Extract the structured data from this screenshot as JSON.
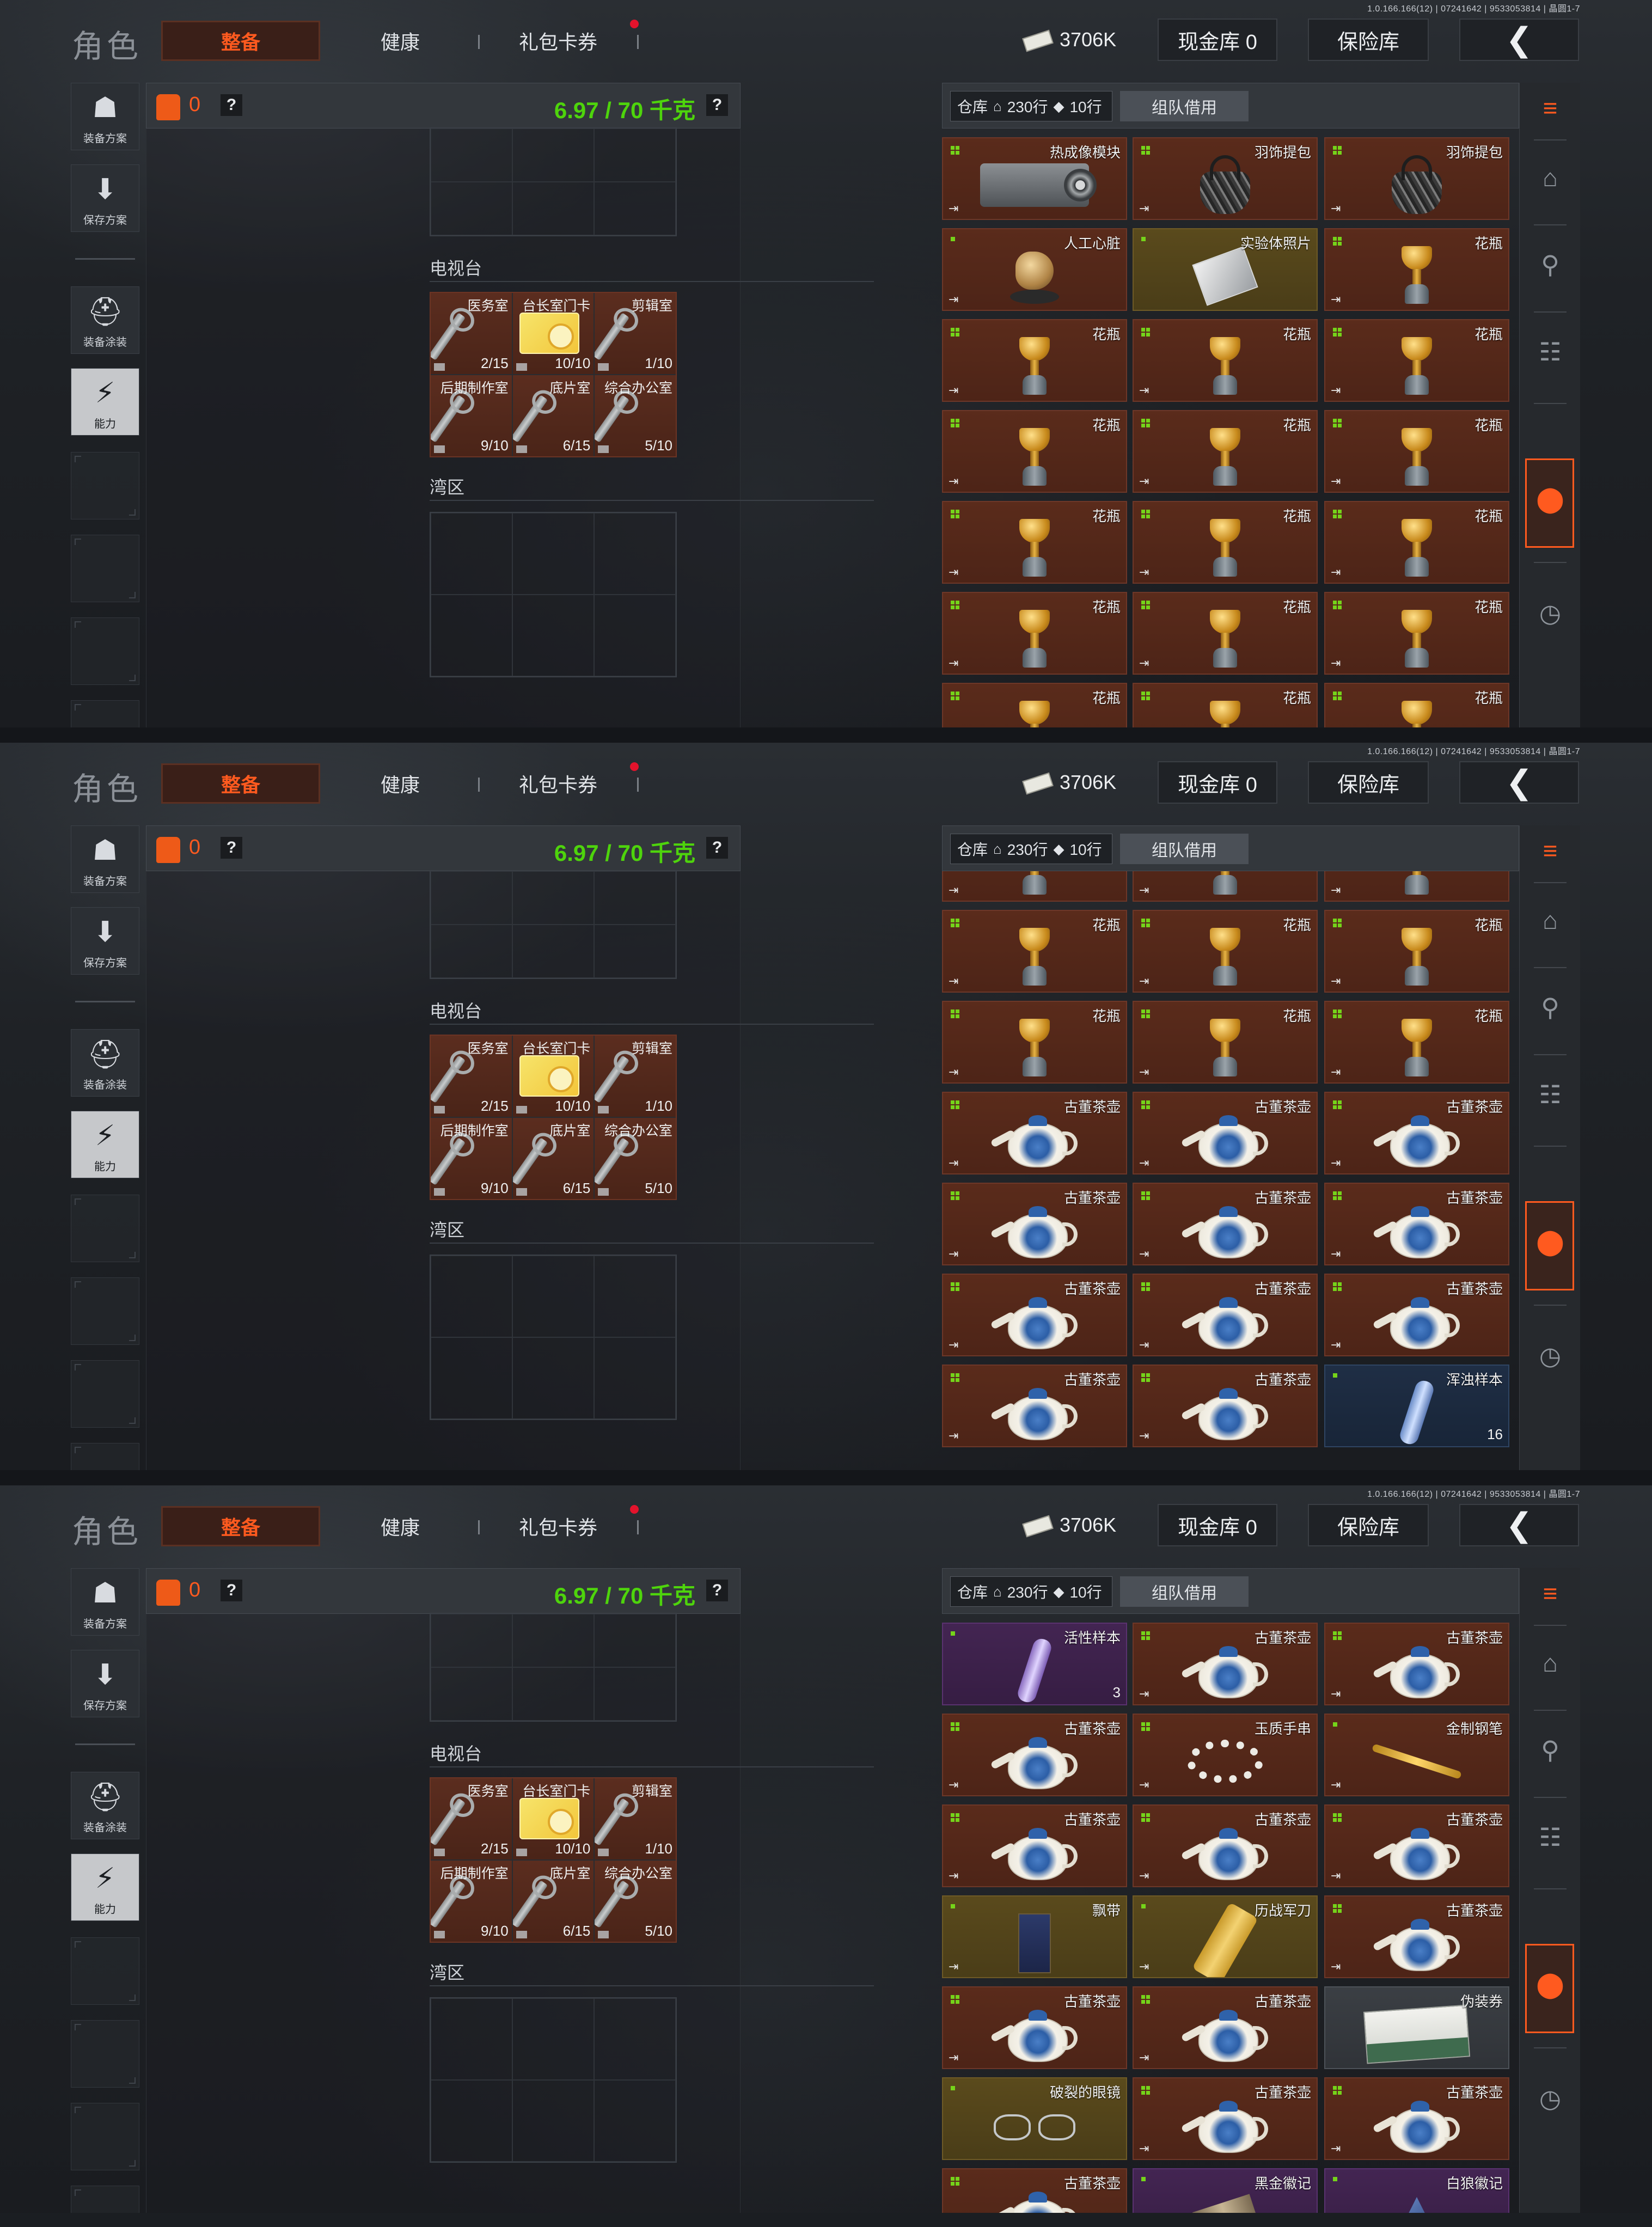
{
  "version": "1.0.166.166(12) | 07241642 | 9533053814 | 晶圆1-7",
  "header": {
    "role_title": "角色",
    "tabs": [
      {
        "label": "整备",
        "active": true
      },
      {
        "label": "健康",
        "active": false
      },
      {
        "label": "礼包卡券",
        "active": false,
        "has_notification": true
      }
    ],
    "money": "3706K",
    "cash_vault_label": "现金库 0",
    "safe_label": "保险库",
    "back_icon": "chevron-left-icon"
  },
  "sidebar": {
    "items": [
      {
        "label": "装备方案",
        "icon": "vest-icon"
      },
      {
        "label": "保存方案",
        "icon": "download-icon"
      },
      {
        "label": "装备涂装",
        "icon": "helmet-icon"
      },
      {
        "label": "能力",
        "icon": "ability-icon",
        "selected": true
      }
    ]
  },
  "loadout": {
    "bag_count": "0",
    "help": "?",
    "weight": "6.97 / 70 千克",
    "sections": [
      {
        "label": "电视台"
      },
      {
        "label": "湾区"
      }
    ],
    "keys": [
      {
        "name": "医务室",
        "count": "2/15",
        "type": "key"
      },
      {
        "name": "台长室门卡",
        "count": "10/10",
        "type": "card"
      },
      {
        "name": "剪辑室",
        "count": "1/10",
        "type": "key"
      },
      {
        "name": "后期制作室",
        "count": "9/10",
        "type": "key"
      },
      {
        "name": "底片室",
        "count": "6/15",
        "type": "key"
      },
      {
        "name": "综合办公室",
        "count": "5/10",
        "type": "key"
      }
    ]
  },
  "warehouse": {
    "label": "仓库",
    "rows_label": "230行",
    "extra_label": "10行",
    "team_borrow": "组队借用",
    "rail_icons": [
      "warehouse-sort-icon",
      "home-icon",
      "key-icon",
      "cash-icon",
      "loot-icon",
      "clock-icon"
    ],
    "frames": [
      {
        "items": [
          {
            "name": "热成像模块",
            "art": "thermal",
            "rarity": "red",
            "marker": "sq4",
            "exit": true
          },
          {
            "name": "羽饰提包",
            "art": "bag",
            "rarity": "red",
            "marker": "sq4",
            "exit": true
          },
          {
            "name": "羽饰提包",
            "art": "bag",
            "rarity": "red",
            "marker": "sq4",
            "exit": true
          },
          {
            "name": "人工心脏",
            "art": "heart",
            "rarity": "red",
            "marker": "sq1",
            "exit": true
          },
          {
            "name": "实验体照片",
            "art": "photo",
            "rarity": "gold",
            "marker": "sq1",
            "exit": false
          },
          {
            "name": "花瓶",
            "art": "vase",
            "rarity": "red",
            "marker": "sq4",
            "exit": true
          },
          {
            "name": "花瓶",
            "art": "vase",
            "rarity": "red",
            "marker": "sq4",
            "exit": true
          },
          {
            "name": "花瓶",
            "art": "vase",
            "rarity": "red",
            "marker": "sq4",
            "exit": true
          },
          {
            "name": "花瓶",
            "art": "vase",
            "rarity": "red",
            "marker": "sq4",
            "exit": true
          },
          {
            "name": "花瓶",
            "art": "vase",
            "rarity": "red",
            "marker": "sq4",
            "exit": true
          },
          {
            "name": "花瓶",
            "art": "vase",
            "rarity": "red",
            "marker": "sq4",
            "exit": true
          },
          {
            "name": "花瓶",
            "art": "vase",
            "rarity": "red",
            "marker": "sq4",
            "exit": true
          },
          {
            "name": "花瓶",
            "art": "vase",
            "rarity": "red",
            "marker": "sq4",
            "exit": true
          },
          {
            "name": "花瓶",
            "art": "vase",
            "rarity": "red",
            "marker": "sq4",
            "exit": true
          },
          {
            "name": "花瓶",
            "art": "vase",
            "rarity": "red",
            "marker": "sq4",
            "exit": true
          },
          {
            "name": "花瓶",
            "art": "vase",
            "rarity": "red",
            "marker": "sq4",
            "exit": true
          },
          {
            "name": "花瓶",
            "art": "vase",
            "rarity": "red",
            "marker": "sq4",
            "exit": true
          },
          {
            "name": "花瓶",
            "art": "vase",
            "rarity": "red",
            "marker": "sq4",
            "exit": true
          },
          {
            "name": "花瓶",
            "art": "vase",
            "rarity": "red",
            "marker": "sq4",
            "exit": true
          },
          {
            "name": "花瓶",
            "art": "vase",
            "rarity": "red",
            "marker": "sq4",
            "exit": true
          },
          {
            "name": "花瓶",
            "art": "vase",
            "rarity": "red",
            "marker": "sq4",
            "exit": true
          }
        ]
      },
      {
        "items": [
          {
            "name": "",
            "art": "vase",
            "rarity": "red",
            "marker": "none",
            "exit": true
          },
          {
            "name": "",
            "art": "vase",
            "rarity": "red",
            "marker": "none",
            "exit": true
          },
          {
            "name": "",
            "art": "vase",
            "rarity": "red",
            "marker": "none",
            "exit": true
          },
          {
            "name": "花瓶",
            "art": "vase",
            "rarity": "red",
            "marker": "sq4",
            "exit": true
          },
          {
            "name": "花瓶",
            "art": "vase",
            "rarity": "red",
            "marker": "sq4",
            "exit": true
          },
          {
            "name": "花瓶",
            "art": "vase",
            "rarity": "red",
            "marker": "sq4",
            "exit": true
          },
          {
            "name": "花瓶",
            "art": "vase",
            "rarity": "red",
            "marker": "sq4",
            "exit": true
          },
          {
            "name": "花瓶",
            "art": "vase",
            "rarity": "red",
            "marker": "sq4",
            "exit": true
          },
          {
            "name": "花瓶",
            "art": "vase",
            "rarity": "red",
            "marker": "sq4",
            "exit": true
          },
          {
            "name": "古董茶壶",
            "art": "teapot",
            "rarity": "red",
            "marker": "sq4",
            "exit": true
          },
          {
            "name": "古董茶壶",
            "art": "teapot",
            "rarity": "red",
            "marker": "sq4",
            "exit": true
          },
          {
            "name": "古董茶壶",
            "art": "teapot",
            "rarity": "red",
            "marker": "sq4",
            "exit": true
          },
          {
            "name": "古董茶壶",
            "art": "teapot",
            "rarity": "red",
            "marker": "sq4",
            "exit": true
          },
          {
            "name": "古董茶壶",
            "art": "teapot",
            "rarity": "red",
            "marker": "sq4",
            "exit": true
          },
          {
            "name": "古董茶壶",
            "art": "teapot",
            "rarity": "red",
            "marker": "sq4",
            "exit": true
          },
          {
            "name": "古董茶壶",
            "art": "teapot",
            "rarity": "red",
            "marker": "sq4",
            "exit": true
          },
          {
            "name": "古董茶壶",
            "art": "teapot",
            "rarity": "red",
            "marker": "sq4",
            "exit": true
          },
          {
            "name": "古董茶壶",
            "art": "teapot",
            "rarity": "red",
            "marker": "sq4",
            "exit": true
          },
          {
            "name": "古董茶壶",
            "art": "teapot",
            "rarity": "red",
            "marker": "sq4",
            "exit": true
          },
          {
            "name": "古董茶壶",
            "art": "teapot",
            "rarity": "red",
            "marker": "sq4",
            "exit": true
          },
          {
            "name": "浑浊样本",
            "art": "tube",
            "rarity": "blue",
            "marker": "sq1",
            "exit": false,
            "count": "16"
          }
        ]
      },
      {
        "items": [
          {
            "name": "活性样本",
            "art": "tube-purple",
            "rarity": "purple",
            "marker": "sq1",
            "exit": false,
            "count": "3"
          },
          {
            "name": "古董茶壶",
            "art": "teapot",
            "rarity": "red",
            "marker": "sq4",
            "exit": true
          },
          {
            "name": "古董茶壶",
            "art": "teapot",
            "rarity": "red",
            "marker": "sq4",
            "exit": true
          },
          {
            "name": "古董茶壶",
            "art": "teapot",
            "rarity": "red",
            "marker": "sq4",
            "exit": true
          },
          {
            "name": "玉质手串",
            "art": "beads",
            "rarity": "red",
            "marker": "sq4",
            "exit": true
          },
          {
            "name": "金制钢笔",
            "art": "pen",
            "rarity": "red",
            "marker": "sq1",
            "exit": true
          },
          {
            "name": "古董茶壶",
            "art": "teapot",
            "rarity": "red",
            "marker": "sq4",
            "exit": true
          },
          {
            "name": "古董茶壶",
            "art": "teapot",
            "rarity": "red",
            "marker": "sq4",
            "exit": true
          },
          {
            "name": "古董茶壶",
            "art": "teapot",
            "rarity": "red",
            "marker": "sq4",
            "exit": true
          },
          {
            "name": "飘带",
            "art": "ribbon",
            "rarity": "gold",
            "marker": "sq1",
            "exit": true
          },
          {
            "name": "历战军刀",
            "art": "knife",
            "rarity": "gold",
            "marker": "sq1",
            "exit": true
          },
          {
            "name": "古董茶壶",
            "art": "teapot",
            "rarity": "red",
            "marker": "sq4",
            "exit": true
          },
          {
            "name": "古董茶壶",
            "art": "teapot",
            "rarity": "red",
            "marker": "sq4",
            "exit": true
          },
          {
            "name": "古董茶壶",
            "art": "teapot",
            "rarity": "red",
            "marker": "sq4",
            "exit": true
          },
          {
            "name": "伪装券",
            "art": "ticket",
            "rarity": "grey",
            "marker": "none",
            "exit": false
          },
          {
            "name": "破裂的眼镜",
            "art": "glasses",
            "rarity": "gold",
            "marker": "sq1",
            "exit": false
          },
          {
            "name": "古董茶壶",
            "art": "teapot",
            "rarity": "red",
            "marker": "sq4",
            "exit": true
          },
          {
            "name": "古董茶壶",
            "art": "teapot",
            "rarity": "red",
            "marker": "sq4",
            "exit": true
          },
          {
            "name": "古董茶壶",
            "art": "teapot",
            "rarity": "red",
            "marker": "sq4",
            "exit": true
          },
          {
            "name": "黑金徽记",
            "art": "badge",
            "rarity": "purple",
            "marker": "sq1",
            "exit": false
          },
          {
            "name": "白狼徽记",
            "art": "badge-wolf",
            "rarity": "purple",
            "marker": "sq1",
            "exit": false
          }
        ]
      }
    ]
  }
}
